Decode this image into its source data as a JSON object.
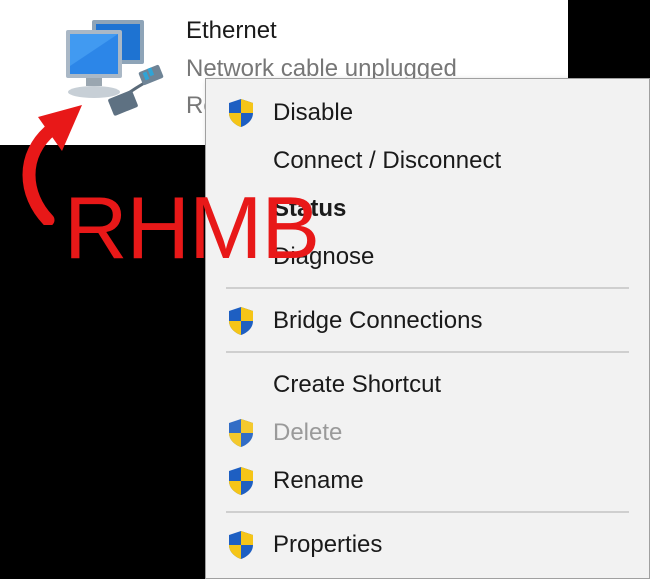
{
  "connection": {
    "name": "Ethernet",
    "status": "Network cable unplugged",
    "sub": "Re"
  },
  "annotation": {
    "text": "RHMB",
    "color": "#e81818"
  },
  "menu": {
    "items": [
      {
        "label": "Disable",
        "shield": true,
        "bold": false,
        "disabled": false
      },
      {
        "label": "Connect / Disconnect",
        "shield": false,
        "bold": false,
        "disabled": false
      },
      {
        "label": "Status",
        "shield": false,
        "bold": true,
        "disabled": false
      },
      {
        "label": "Diagnose",
        "shield": false,
        "bold": false,
        "disabled": false
      },
      {
        "label": "Bridge Connections",
        "shield": true,
        "bold": false,
        "disabled": false
      },
      {
        "label": "Create Shortcut",
        "shield": false,
        "bold": false,
        "disabled": false
      },
      {
        "label": "Delete",
        "shield": true,
        "bold": false,
        "disabled": true
      },
      {
        "label": "Rename",
        "shield": true,
        "bold": false,
        "disabled": false
      },
      {
        "label": "Properties",
        "shield": true,
        "bold": false,
        "disabled": false
      }
    ]
  }
}
